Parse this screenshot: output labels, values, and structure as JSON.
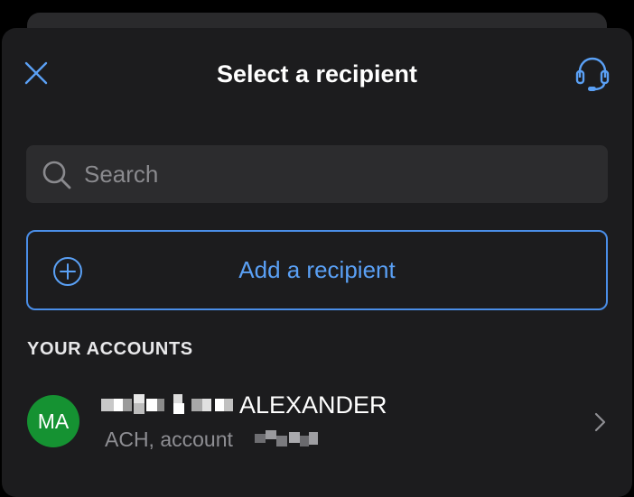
{
  "header": {
    "title": "Select a recipient",
    "close_icon": "close-icon",
    "support_icon": "headset-icon"
  },
  "search": {
    "placeholder": "Search",
    "value": "",
    "icon": "search-icon"
  },
  "add_recipient": {
    "label": "Add a recipient",
    "icon": "plus-circle-icon"
  },
  "accounts": {
    "section_title": "YOUR ACCOUNTS",
    "items": [
      {
        "initials": "MA",
        "name_visible": "ALEXANDER",
        "subtitle": "ACH, account",
        "avatar_color": "#159232"
      }
    ]
  },
  "colors": {
    "background": "#1c1c1e",
    "accent": "#5aa0f5",
    "field": "#2c2c2e",
    "muted_text": "#8e8e93"
  }
}
